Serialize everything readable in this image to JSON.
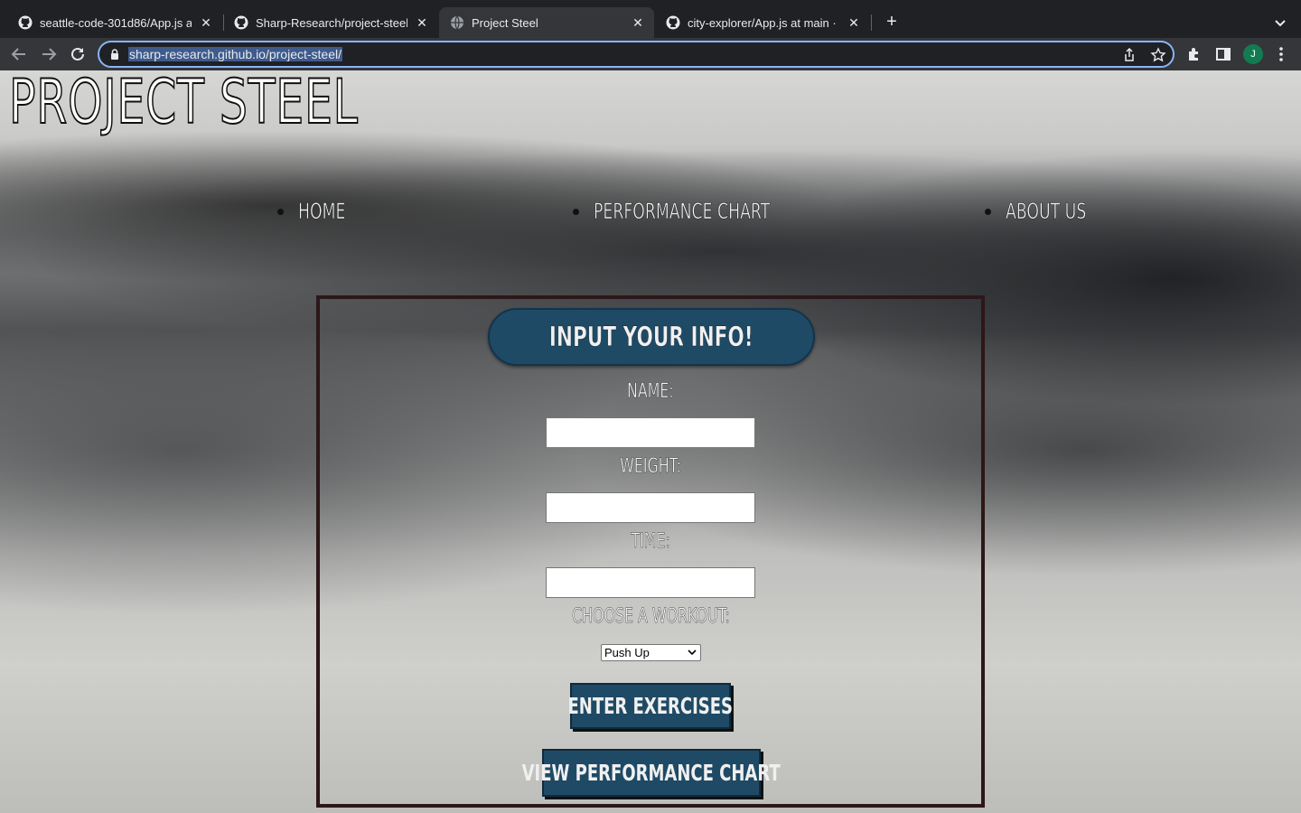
{
  "browser": {
    "tabs": [
      {
        "title": "seattle-code-301d86/App.js at",
        "icon": "github-icon",
        "active": false
      },
      {
        "title": "Sharp-Research/project-steel",
        "icon": "github-icon",
        "active": false
      },
      {
        "title": "Project Steel",
        "icon": "globe-icon",
        "active": true
      },
      {
        "title": "city-explorer/App.js at main · S",
        "icon": "github-icon",
        "active": false
      }
    ],
    "close_glyph": "✕",
    "new_tab_glyph": "+",
    "url": "sharp-research.github.io/project-steel/",
    "avatar_letter": "J",
    "accent_color": "#8ab4f8"
  },
  "page": {
    "site_title": "PROJECT STEEL",
    "nav": [
      {
        "label": "HOME"
      },
      {
        "label": "PERFORMANCE CHART"
      },
      {
        "label": "ABOUT US"
      }
    ],
    "form": {
      "heading": "INPUT YOUR INFO!",
      "name_label": "NAME:",
      "name_value": "",
      "weight_label": "WEIGHT:",
      "weight_value": "",
      "time_label": "TIME:",
      "time_value": "",
      "workout_label": "CHOOSE A WORKOUT:",
      "workout_selected": "Push Up",
      "enter_button": "ENTER EXERCISES",
      "chart_button": "VIEW PERFORMANCE CHART"
    },
    "colors": {
      "button_bg": "#1f4a65",
      "form_border": "#2c1719"
    }
  }
}
